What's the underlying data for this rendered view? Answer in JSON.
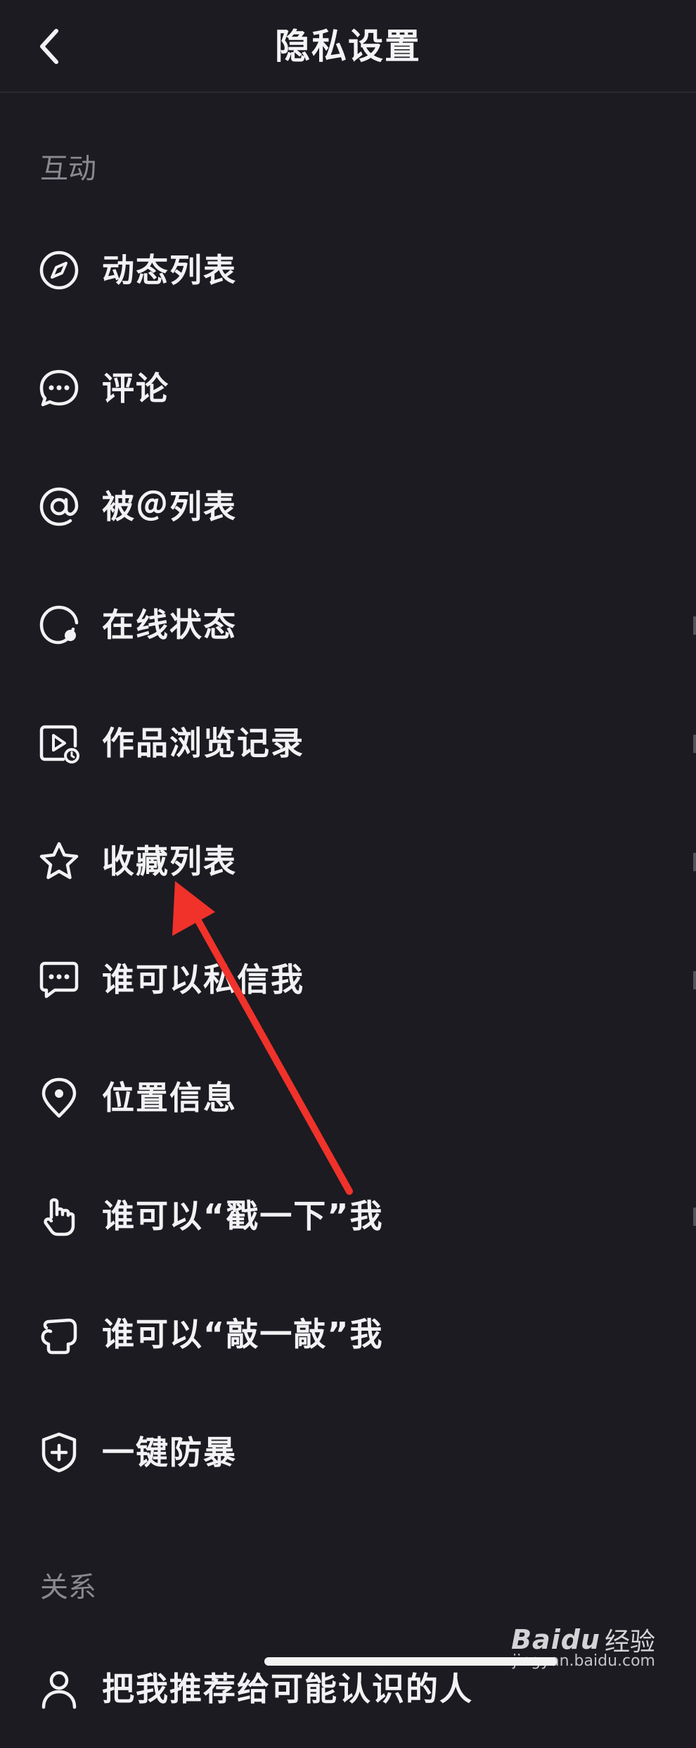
{
  "header": {
    "title": "隐私设置",
    "back_icon": "chevron-left-icon"
  },
  "sections": [
    {
      "title": "互动"
    },
    {
      "title": "关系"
    }
  ],
  "items": [
    {
      "label": "动态列表",
      "icon": "compass-icon"
    },
    {
      "label": "评论",
      "icon": "chat-bubble-icon"
    },
    {
      "label": "被＠列表",
      "icon": "at-sign-icon"
    },
    {
      "label": "在线状态",
      "icon": "online-status-icon"
    },
    {
      "label": "作品浏览记录",
      "icon": "video-history-icon"
    },
    {
      "label": "收藏列表",
      "icon": "star-icon"
    },
    {
      "label": "谁可以私信我",
      "icon": "message-icon"
    },
    {
      "label": "位置信息",
      "icon": "location-pin-icon"
    },
    {
      "label": "谁可以“戳一下”我",
      "icon": "tap-hand-icon"
    },
    {
      "label": "谁可以“敲一敲”我",
      "icon": "knock-hand-icon"
    },
    {
      "label": "一键防暴",
      "icon": "shield-plus-icon"
    },
    {
      "label": "把我推荐给可能认识的人",
      "icon": "person-icon"
    }
  ],
  "annotation": {
    "color": "#f0322b"
  },
  "watermark": {
    "logo": "Baidu",
    "text": "经验",
    "url": "jingyan.baidu.com"
  },
  "colors": {
    "background": "#1c1b21",
    "text_primary": "#f2f2f4",
    "text_secondary": "#8a8990"
  }
}
